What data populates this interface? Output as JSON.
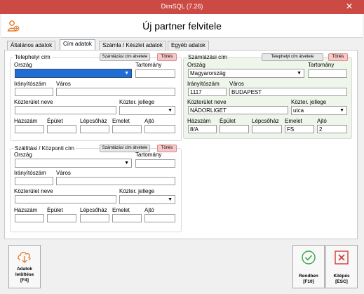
{
  "window": {
    "title": "DimSQL (7.26)",
    "close": "✕"
  },
  "header": {
    "title": "Új partner felvitele"
  },
  "tabs": [
    {
      "label": "Általános adatok"
    },
    {
      "label": "Cím adatok"
    },
    {
      "label": "Számla / Készlet adatok"
    },
    {
      "label": "Egyéb adatok"
    }
  ],
  "telephelyi": {
    "legend": "Telephelyi cím",
    "copy_btn": "Számlázási cím átvétele",
    "del_btn": "Törlés",
    "labels": {
      "orszag": "Ország",
      "tartomany": "Tartomány",
      "irsz": "Irányítószám",
      "varos": "Város",
      "kozterulet": "Közterület neve",
      "jelleg": "Közter. jellege",
      "hazszam": "Házszám",
      "epulet": "Épület",
      "lepcsohaz": "Lépcsőház",
      "emelet": "Emelet",
      "ajto": "Ajtó"
    },
    "values": {
      "orszag": "",
      "tartomany": "",
      "irsz": "",
      "varos": "",
      "kozterulet": "",
      "jelleg": "",
      "hazszam": "",
      "epulet": "",
      "lepcsohaz": "",
      "emelet": "",
      "ajto": ""
    }
  },
  "szamlazasi": {
    "legend": "Számlázási cím",
    "copy_btn": "Telephelyi cím átvétele",
    "del_btn": "Törlés",
    "labels": {
      "orszag": "Ország",
      "tartomany": "Tartomány",
      "irsz": "Irányítószám",
      "varos": "Város",
      "kozterulet": "Közterület neve",
      "jelleg": "Közter. jellege",
      "hazszam": "Házszám",
      "epulet": "Épület",
      "lepcsohaz": "Lépcsőház",
      "emelet": "Emelet",
      "ajto": "Ajtó"
    },
    "values": {
      "orszag": "Magyarország",
      "tartomany": "",
      "irsz": "1117",
      "varos": "BUDAPEST",
      "kozterulet": "NÁDORLIGET",
      "jelleg": "utca",
      "hazszam": "8/A",
      "epulet": "",
      "lepcsohaz": "",
      "emelet": "FS",
      "ajto": "2"
    }
  },
  "szallitasi": {
    "legend": "Szállítási / Központi cím",
    "copy_btn": "Számlázási cím átvétele",
    "del_btn": "Törlés",
    "labels": {
      "orszag": "Ország",
      "tartomany": "Tartomány",
      "irsz": "Irányítószám",
      "varos": "Város",
      "kozterulet": "Közterület neve",
      "jelleg": "Közter. jellege",
      "hazszam": "Házszám",
      "epulet": "Épület",
      "lepcsohaz": "Lépcsőház",
      "emelet": "Emelet",
      "ajto": "Ajtó"
    },
    "values": {
      "orszag": "",
      "tartomany": "",
      "irsz": "",
      "varos": "",
      "kozterulet": "",
      "jelleg": "",
      "hazszam": "",
      "epulet": "",
      "lepcsohaz": "",
      "emelet": "",
      "ajto": ""
    }
  },
  "buttons": {
    "download": {
      "line1": "Adatok",
      "line2": "letöltése",
      "key": "[F4]"
    },
    "ok": {
      "line1": "Rendben",
      "key": "[F10]"
    },
    "exit": {
      "line1": "Kilépés",
      "key": "[ESC]"
    }
  },
  "icons": {
    "app": "user-add-icon",
    "download": "cloud-download-icon",
    "ok": "check-circle-icon",
    "exit": "close-box-icon",
    "dropdown": "chevron-down-icon"
  },
  "colors": {
    "titlebar": "#cc4a44",
    "ok_green": "#3aa64a",
    "exit_red": "#d33b3b",
    "download_orange": "#e07a2a",
    "focus_blue": "#1e6ed3",
    "delete_btn": "#f6c9c9"
  }
}
